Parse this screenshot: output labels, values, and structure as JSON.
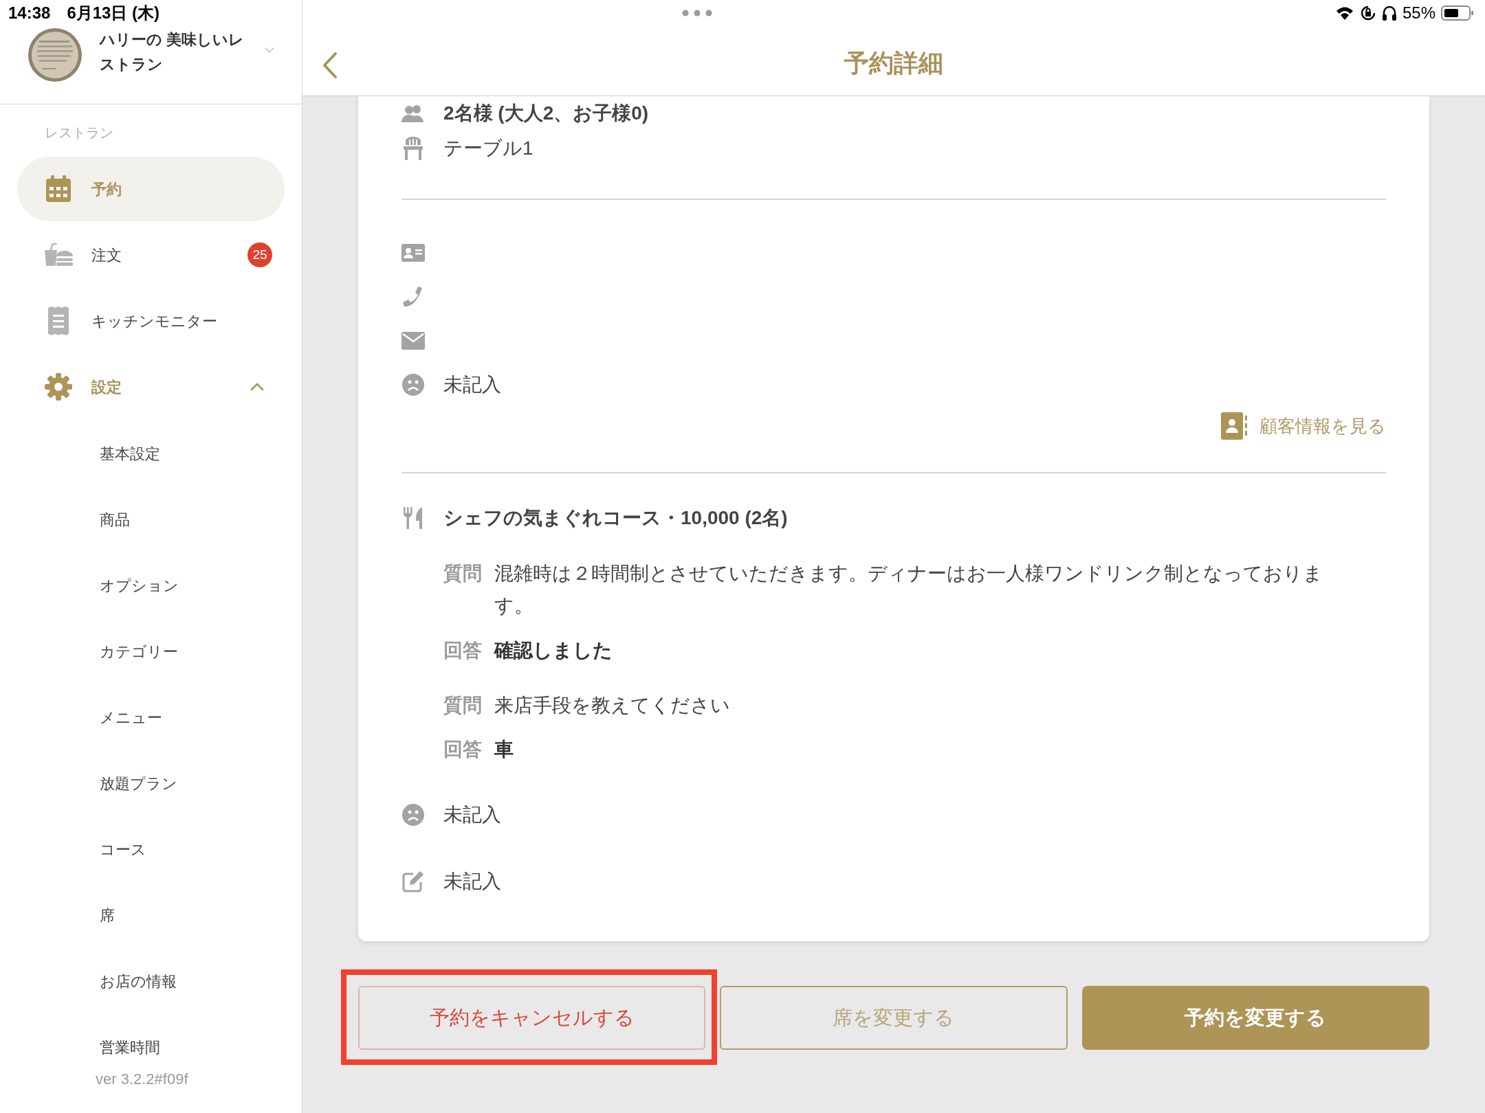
{
  "status_bar": {
    "time": "14:38",
    "date": "6月13日 (木)",
    "battery": "55%"
  },
  "sidebar": {
    "restaurant_name": "ハリーの 美味しいレストラン",
    "section_label": "レストラン",
    "items": [
      {
        "label": "予約",
        "kind": "calendar",
        "selected": true
      },
      {
        "label": "注文",
        "kind": "food",
        "selected": false,
        "badge": "25"
      },
      {
        "label": "キッチンモニター",
        "kind": "receipt",
        "selected": false
      },
      {
        "label": "設定",
        "kind": "gear",
        "selected": false,
        "expanded": true,
        "children": [
          {
            "label": "基本設定"
          },
          {
            "label": "商品"
          },
          {
            "label": "オプション"
          },
          {
            "label": "カテゴリー"
          },
          {
            "label": "メニュー"
          },
          {
            "label": "放題プラン"
          },
          {
            "label": "コース"
          },
          {
            "label": "席"
          },
          {
            "label": "お店の情報"
          },
          {
            "label": "営業時間"
          }
        ]
      }
    ],
    "version": "ver 3.2.2#f09f"
  },
  "header": {
    "title": "予約詳細"
  },
  "detail": {
    "booking_rows": [
      {
        "kind": "party",
        "text": "2名様 (大人2、お子様0)"
      },
      {
        "kind": "seat",
        "text": "テーブル1"
      }
    ],
    "customer_rows": [
      {
        "kind": "id"
      },
      {
        "kind": "phone"
      },
      {
        "kind": "mail"
      },
      {
        "kind": "unknown",
        "text": "未記入"
      }
    ],
    "customer_link": "顧客情報を見る",
    "course": {
      "title": "シェフの気まぐれコース・10,000 (2名)",
      "qa": [
        {
          "question_label": "質問",
          "question": "混雑時は２時間制とさせていただきます。ディナーはお一人様ワンドリンク制となっております。",
          "answer_label": "回答",
          "answer": "確認しました"
        },
        {
          "question_label": "質問",
          "question": "来店手段を教えてください",
          "answer_label": "回答",
          "answer": "車"
        }
      ]
    },
    "note_rows": [
      {
        "kind": "unknown",
        "text": "未記入"
      },
      {
        "kind": "memo",
        "text": "未記入"
      }
    ]
  },
  "buttons": [
    {
      "label": "予約をキャンセルする",
      "kind": "danger",
      "highlighted": true
    },
    {
      "label": "席を変更する",
      "kind": "outline",
      "highlighted": false
    },
    {
      "label": "予約を変更する",
      "kind": "primary",
      "highlighted": false
    }
  ]
}
